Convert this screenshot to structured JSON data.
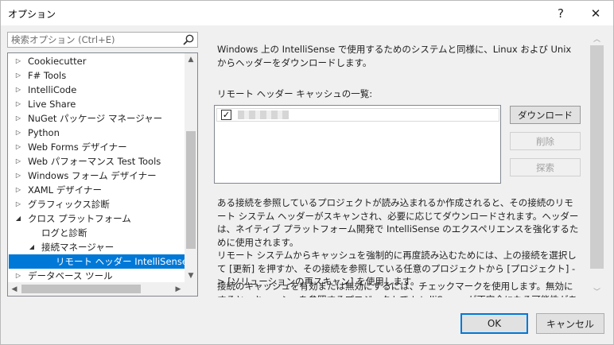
{
  "window": {
    "title": "オプション",
    "help_glyph": "?",
    "close_glyph": "✕"
  },
  "search": {
    "placeholder": "検索オプション (Ctrl+E)"
  },
  "tree": {
    "items": [
      {
        "label": "Cookiecutter",
        "expanded": false,
        "level": 0
      },
      {
        "label": "F# Tools",
        "expanded": false,
        "level": 0
      },
      {
        "label": "IntelliCode",
        "expanded": false,
        "level": 0
      },
      {
        "label": "Live Share",
        "expanded": false,
        "level": 0
      },
      {
        "label": "NuGet パッケージ マネージャー",
        "expanded": false,
        "level": 0
      },
      {
        "label": "Python",
        "expanded": false,
        "level": 0
      },
      {
        "label": "Web Forms デザイナー",
        "expanded": false,
        "level": 0
      },
      {
        "label": "Web パフォーマンス Test Tools",
        "expanded": false,
        "level": 0
      },
      {
        "label": "Windows フォーム デザイナー",
        "expanded": false,
        "level": 0
      },
      {
        "label": "XAML デザイナー",
        "expanded": false,
        "level": 0
      },
      {
        "label": "グラフィックス診断",
        "expanded": false,
        "level": 0
      },
      {
        "label": "クロス プラットフォーム",
        "expanded": true,
        "level": 0
      },
      {
        "label": "ログと診断",
        "expanded": null,
        "level": 1
      },
      {
        "label": "接続マネージャー",
        "expanded": true,
        "level": 1
      },
      {
        "label": "リモート ヘッダー IntelliSense マネー",
        "expanded": null,
        "level": 2,
        "selected": true
      },
      {
        "label": "データベース ツール",
        "expanded": false,
        "level": 0
      }
    ]
  },
  "content": {
    "description": "Windows 上の IntelliSense で使用するためのシステムと同様に、Linux および Unix からヘッダーをダウンロードします。",
    "list_label": "リモート ヘッダー キャッシュの一覧:",
    "cache_entries": [
      {
        "checked": true,
        "check_glyph": "✓"
      }
    ],
    "buttons": {
      "download": "ダウンロード",
      "delete": "削除",
      "explore": "探索"
    },
    "info_paragraph_1": "ある接続を参照しているプロジェクトが読み込まれるか作成されると、その接続のリモート システム ヘッダーがスキャンされ、必要に応じてダウンロードされます。ヘッダーは、ネイティブ プラットフォーム開発で IntelliSense のエクスペリエンスを強化するために使用されます。",
    "info_paragraph_2": "リモート システムからキャッシュを強制的に再度読み込むためには、上の接続を選択して [更新] を押すか、その接続を参照している任意のプロジェクトから [プロジェクト] -> [ソリューションの再スキャン] を使用します。",
    "info_paragraph_3": "接続のキャッシュを有効または無効にするには、チェックマークを使用します。無効にすると、キャッシュを参照するプロジェクトで IntelliSense が不完全になる可能性があります。"
  },
  "footer": {
    "ok": "OK",
    "cancel": "キャンセル"
  },
  "colors": {
    "accent": "#0078d7",
    "dialog_bg": "#f0f0f0",
    "selected_text": "#ffffff"
  }
}
